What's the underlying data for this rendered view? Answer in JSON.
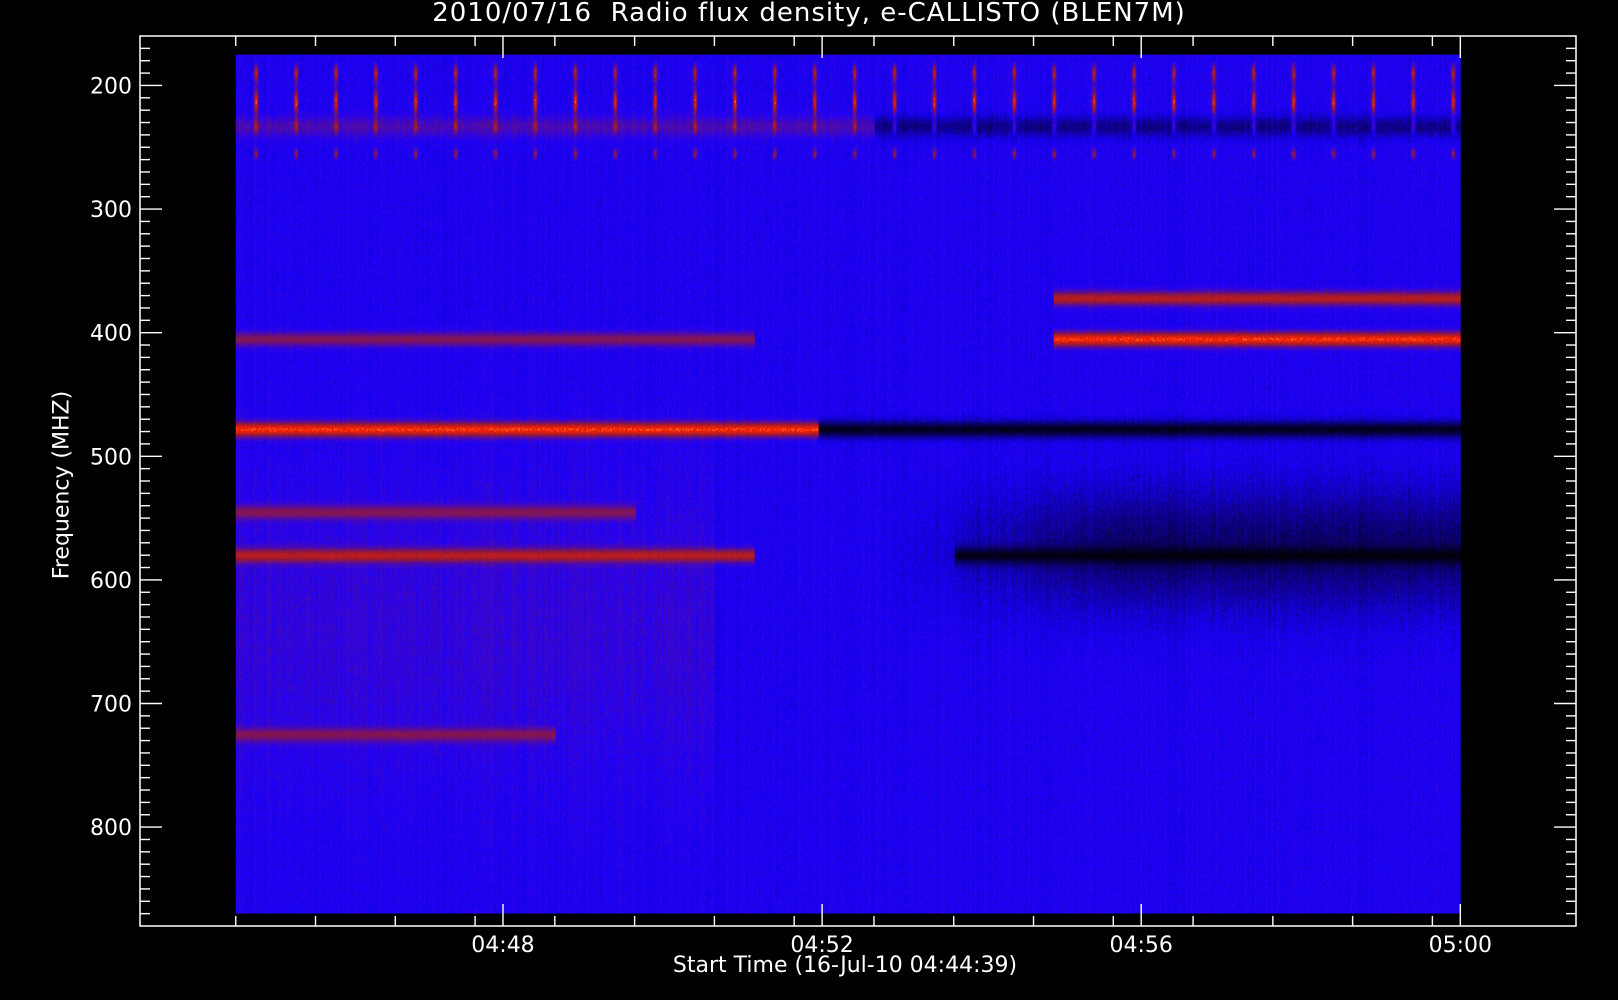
{
  "chart_data": {
    "type": "heatmap",
    "title": "2010/07/16  Radio flux density, e-CALLISTO (BLEN7M)",
    "xlabel": "Start Time (16-Jul-10 04:44:39)",
    "ylabel": "Frequency (MHZ)",
    "x_range_minutes": [
      -1.2,
      16.8
    ],
    "x_ticks": [
      {
        "minute": 3.35,
        "label": "04:48"
      },
      {
        "minute": 7.35,
        "label": "04:52"
      },
      {
        "minute": 11.35,
        "label": "04:56"
      },
      {
        "minute": 15.35,
        "label": "05:00"
      }
    ],
    "data_time_start_minute": 0,
    "data_time_end_minute": 15.35,
    "y_range_mhz": [
      160,
      880
    ],
    "y_reversed": true,
    "y_ticks": [
      200,
      300,
      400,
      500,
      600,
      700,
      800
    ],
    "data_freq_range_mhz": [
      175,
      870
    ],
    "colormap": [
      "#000000",
      "#1a00ff",
      "#9a1a30",
      "#ff2000",
      "#ffff60"
    ],
    "background_level": "blue",
    "features": [
      {
        "kind": "periodic_bursts",
        "freq_mhz": [
          180,
          260
        ],
        "period_min": 0.5,
        "intensity": "red-yellow"
      },
      {
        "kind": "band",
        "freq_mhz": 405,
        "time_min": [
          10.25,
          15.35
        ],
        "intensity": "bright orange"
      },
      {
        "kind": "band",
        "freq_mhz": 372,
        "time_min": [
          10.25,
          15.35
        ],
        "intensity": "red"
      },
      {
        "kind": "band",
        "freq_mhz": 478,
        "time_min": [
          0,
          7.3
        ],
        "intensity": "bright orange"
      },
      {
        "kind": "band",
        "freq_mhz": 478,
        "time_min": [
          7.3,
          15.35
        ],
        "intensity": "black"
      },
      {
        "kind": "band",
        "freq_mhz": 580,
        "time_min": [
          0,
          6.5
        ],
        "intensity": "red"
      },
      {
        "kind": "band",
        "freq_mhz": 545,
        "time_min": [
          0,
          5.0
        ],
        "intensity": "dark red"
      },
      {
        "kind": "band",
        "freq_mhz": 580,
        "time_min": [
          9.0,
          15.35
        ],
        "intensity": "black"
      },
      {
        "kind": "band",
        "freq_mhz": 725,
        "time_min": [
          0,
          4.0
        ],
        "intensity": "dark red"
      },
      {
        "kind": "band",
        "freq_mhz": 405,
        "time_min": [
          0,
          6.5
        ],
        "intensity": "dark red"
      }
    ]
  }
}
